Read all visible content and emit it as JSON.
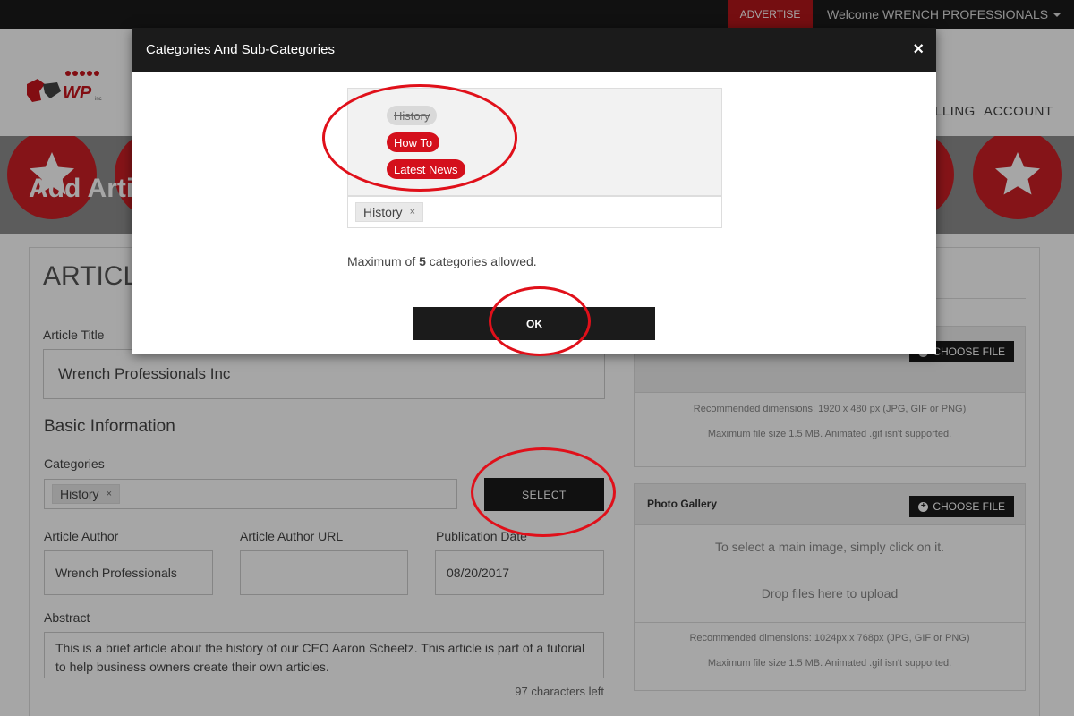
{
  "topbar": {
    "advertise": "ADVERTISE",
    "welcome": "Welcome WRENCH PROFESSIONALS"
  },
  "nav": {
    "items": [
      "LLING",
      "ACCOUNT"
    ]
  },
  "banner": {
    "title": "Add Artic"
  },
  "form": {
    "section_title": "ARTICLE",
    "article_title_label": "Article Title",
    "article_title_value": "Wrench Professionals Inc",
    "basic_info": "Basic Information",
    "categories_label": "Categories",
    "categories_tag": "History",
    "tag_remove": "×",
    "select_button": "SELECT",
    "author_label": "Article Author",
    "author_value": "Wrench Professionals",
    "author_url_label": "Article Author URL",
    "author_url_value": "",
    "pub_date_label": "Publication Date",
    "pub_date_value": "08/20/2017",
    "abstract_label": "Abstract",
    "abstract_value": "This is a brief article about the history of our CEO Aaron Scheetz. This article is part of a tutorial to help business owners create their own articles.",
    "chars_left": "97 characters left"
  },
  "cover_panel": {
    "choose": "CHOOSE FILE",
    "note1": "Recommended dimensions: 1920 x 480 px (JPG, GIF or PNG)",
    "note2": "Maximum file size 1.5 MB. Animated .gif isn't supported."
  },
  "gallery_panel": {
    "title": "Photo Gallery",
    "choose": "CHOOSE FILE",
    "msg1": "To select a main image, simply click on it.",
    "msg2": "Drop files here to upload",
    "note1": "Recommended dimensions: 1024px x 768px (JPG, GIF or PNG)",
    "note2": "Maximum file size 1.5 MB. Animated .gif isn't supported."
  },
  "modal": {
    "title": "Categories And Sub-Categories",
    "close": "×",
    "categories": [
      {
        "label": "History",
        "state": "selected"
      },
      {
        "label": "How To",
        "state": "available"
      },
      {
        "label": "Latest News",
        "state": "available"
      }
    ],
    "chosen_tag": "History",
    "tag_remove": "×",
    "max_prefix": "Maximum of ",
    "max_count": "5",
    "max_suffix": " categories allowed.",
    "ok_button": "OK"
  },
  "colors": {
    "accent_red": "#d4101c",
    "dark": "#1b1b1b"
  }
}
